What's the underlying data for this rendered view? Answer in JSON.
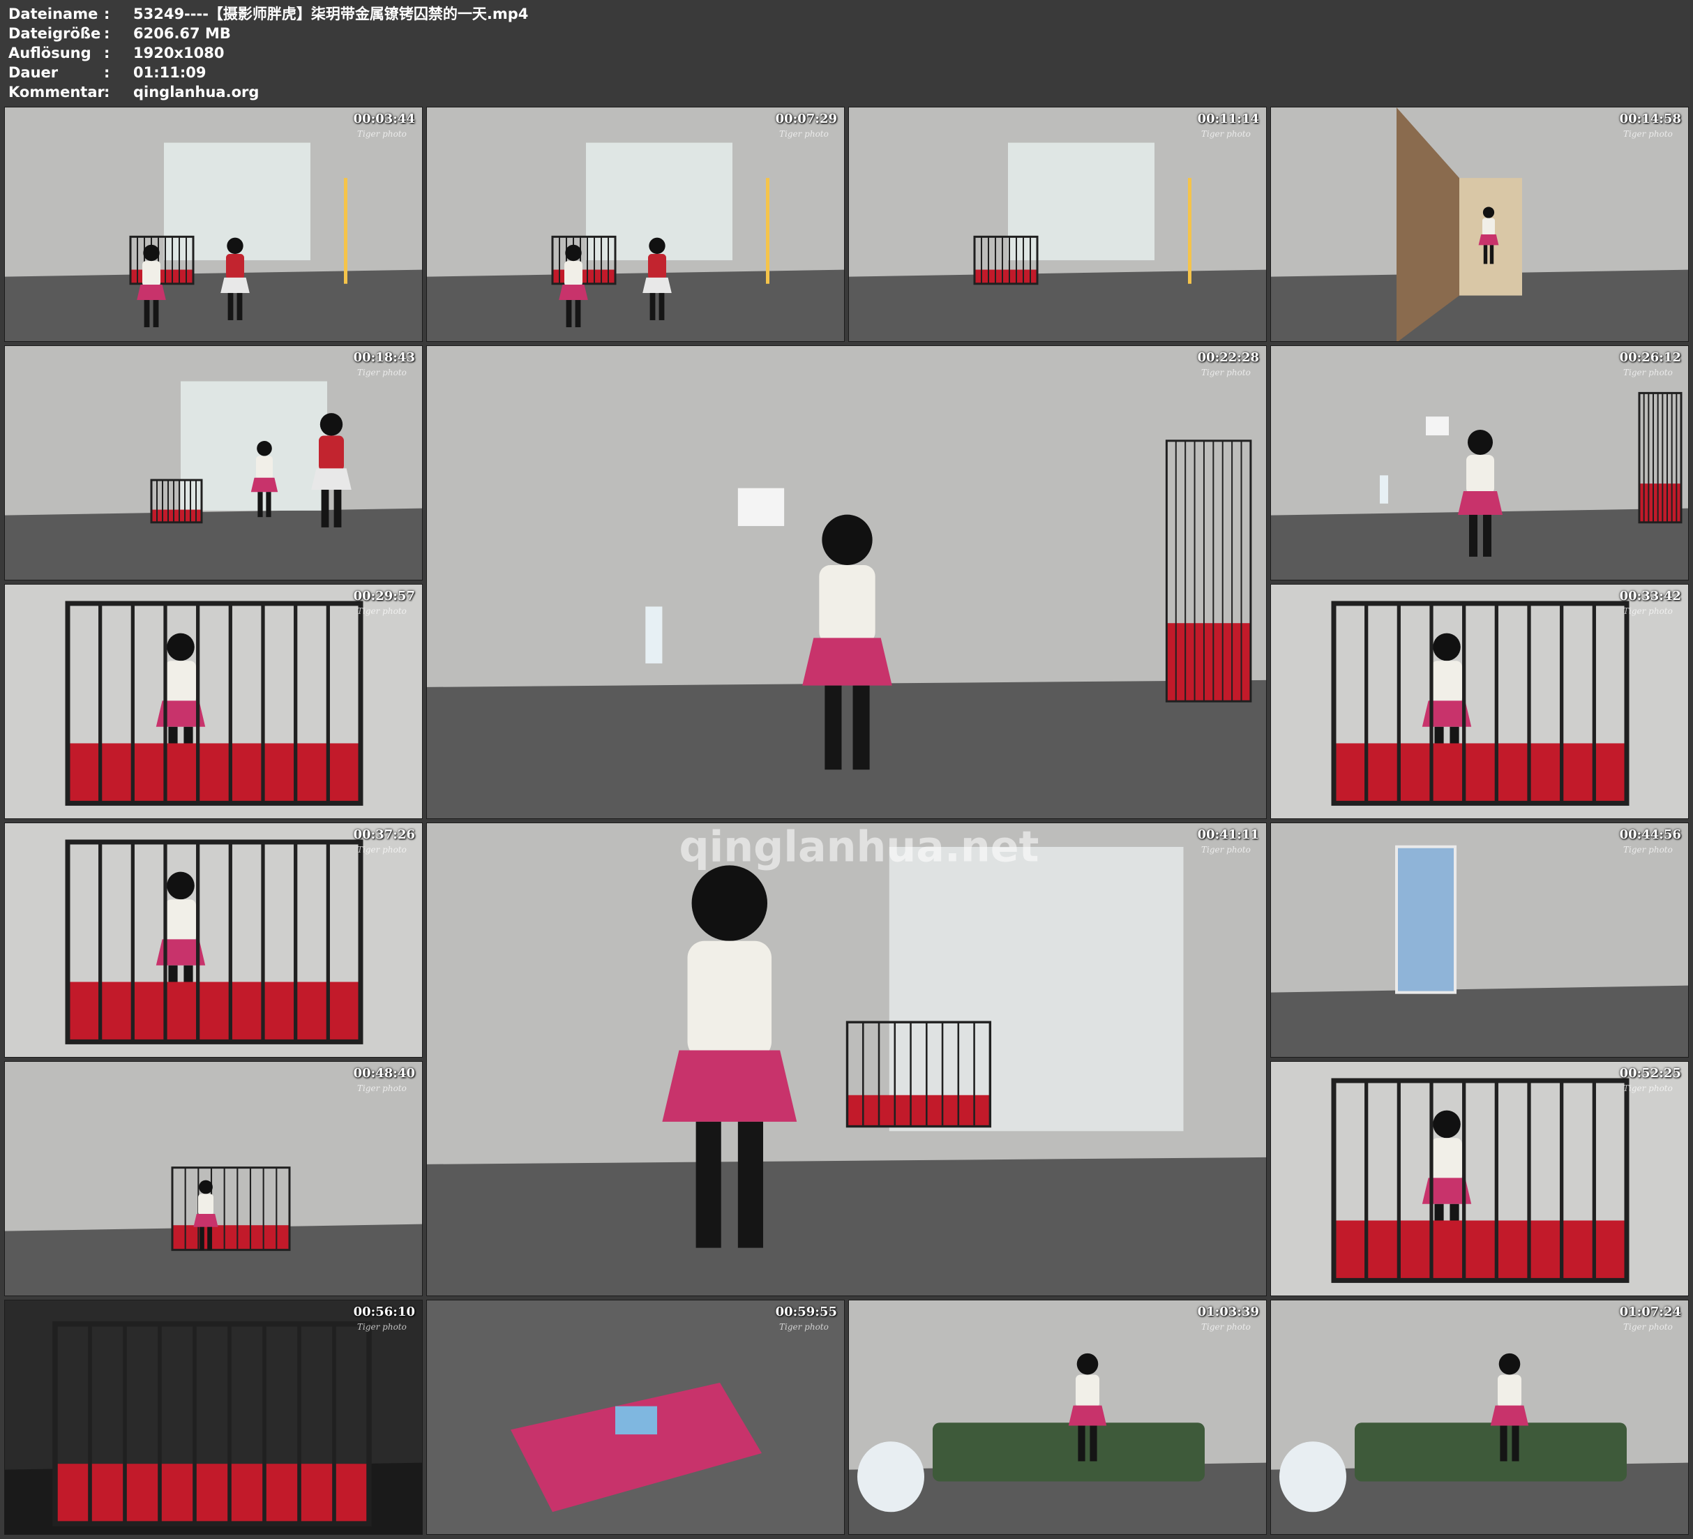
{
  "meta": {
    "rows": [
      {
        "key": "Dateiname",
        "sep": ":",
        "value": "53249----【摄影师胖虎】柒玥带金属镣铐囚禁的一天.mp4"
      },
      {
        "key": "Dateigröße",
        "sep": ":",
        "value": "6206.67 MB"
      },
      {
        "key": "Auflösung",
        "sep": ":",
        "value": "1920x1080"
      },
      {
        "key": "Dauer",
        "sep": ":",
        "value": "01:11:09"
      },
      {
        "key": "Kommentar",
        "sep": ":",
        "value": "qinglanhua.org"
      }
    ]
  },
  "thumbnails": [
    {
      "time": "00:03:44",
      "scene": "room-cage"
    },
    {
      "time": "00:07:29",
      "scene": "room-cage"
    },
    {
      "time": "00:11:14",
      "scene": "room-cage-empty"
    },
    {
      "time": "00:14:58",
      "scene": "hallway"
    },
    {
      "time": "00:18:43",
      "scene": "room-standing"
    },
    {
      "time": "00:22:28",
      "scene": "sitting-wall"
    },
    {
      "time": "00:26:12",
      "scene": "sitting-wall"
    },
    {
      "time": "00:29:57",
      "scene": "cage-close"
    },
    {
      "time": "00:33:42",
      "scene": "cage-close"
    },
    {
      "time": "00:37:26",
      "scene": "cage-close"
    },
    {
      "time": "00:41:11",
      "scene": "standing-cuffed"
    },
    {
      "time": "00:44:56",
      "scene": "door-room"
    },
    {
      "time": "00:48:40",
      "scene": "cage-far"
    },
    {
      "time": "00:52:25",
      "scene": "cage-close"
    },
    {
      "time": "00:56:10",
      "scene": "cage-dark"
    },
    {
      "time": "00:59:55",
      "scene": "lying"
    },
    {
      "time": "01:03:39",
      "scene": "sofa"
    },
    {
      "time": "01:07:24",
      "scene": "sofa"
    }
  ],
  "watermarks": [
    "Tiger photo",
    "qinglanhua.net",
    "qinglanhua.org"
  ],
  "colors": {
    "background": "#3a3a3a",
    "wall": "#bdbdbb",
    "floor": "#5a5a5a",
    "skirt": "#c8336b",
    "cage": "#202020",
    "bed": "#c21a2a"
  }
}
